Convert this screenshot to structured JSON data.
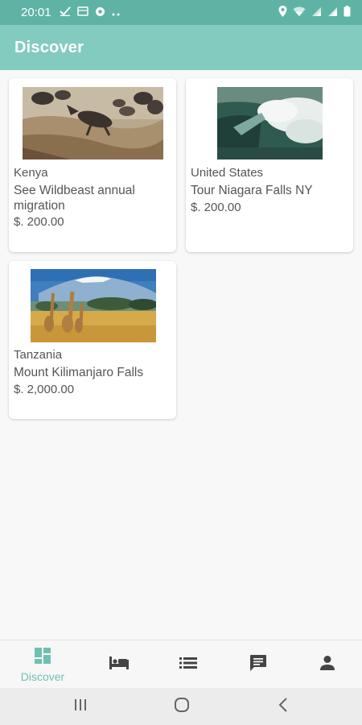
{
  "status_bar": {
    "time": "20:01",
    "left_icons": [
      "download-done-icon",
      "gallery-icon",
      "chrome-icon",
      "more-dots-icon"
    ],
    "right_icons": [
      "location-icon",
      "wifi-icon",
      "signal-icon",
      "signal-icon-2",
      "battery-icon"
    ]
  },
  "app_bar": {
    "title": "Discover"
  },
  "colors": {
    "status_bar": "#5fb3a5",
    "app_bar": "#84cbbf",
    "accent": "#6fc0b2",
    "text": "#555555"
  },
  "places": [
    {
      "country": "Kenya",
      "name": "See Wildbeast annual migration",
      "price": "$. 200.00",
      "image": "wildebeest-migration-photo"
    },
    {
      "country": "United States",
      "name": "Tour Niagara Falls NY",
      "price": "$. 200.00",
      "image": "niagara-falls-photo"
    },
    {
      "country": "Tanzania",
      "name": "Mount Kilimanjaro  Falls",
      "price": "$. 2,000.00",
      "image": "kilimanjaro-giraffes-photo"
    }
  ],
  "bottom_nav": [
    {
      "label": "Discover",
      "icon": "dashboard-icon",
      "active": true
    },
    {
      "label": "",
      "icon": "bed-icon",
      "active": false
    },
    {
      "label": "",
      "icon": "list-icon",
      "active": false
    },
    {
      "label": "",
      "icon": "chat-icon",
      "active": false
    },
    {
      "label": "",
      "icon": "person-icon",
      "active": false
    }
  ],
  "system_nav": [
    "recents-button",
    "home-button",
    "back-button"
  ]
}
